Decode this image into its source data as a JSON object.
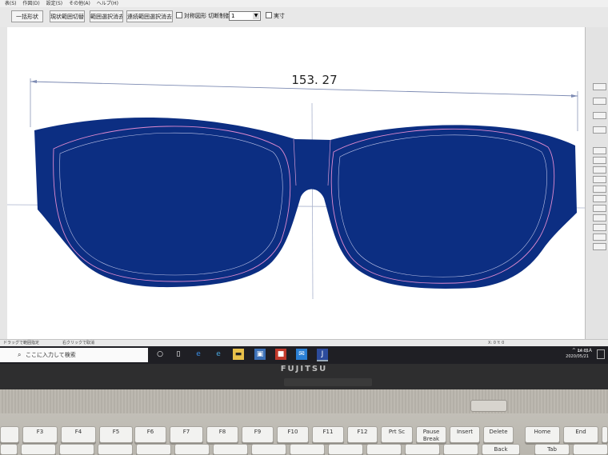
{
  "menu": {
    "items": [
      "表(S)",
      "作図(D)",
      "設定(S)",
      "その他(A)",
      "ヘルプ(H)"
    ]
  },
  "toolbar": {
    "buttons": [
      "一括形状",
      "現状範囲切替",
      "範囲選択消去",
      "連続範囲選択消去"
    ],
    "checkbox1_label": "対称図形 切断制御",
    "select_value": "1",
    "checkbox2_label": "実寸"
  },
  "drawing": {
    "dimension_value": "153. 27"
  },
  "colors": {
    "lens_fill": "#0c2e82",
    "outline_pink": "#e08ad0",
    "guide_line": "#9aa6c4"
  },
  "status": {
    "left_text": "ドラッグで範囲指定",
    "middle_text": "右クリックで取消",
    "right_text": "X: 0  Y: 0"
  },
  "taskbar": {
    "search_placeholder": "ここに入力して検索",
    "icons": [
      "task-view-icon",
      "edge-icon",
      "file-explorer-icon",
      "store-icon",
      "app-icon",
      "mail-icon",
      "cad-app-icon"
    ],
    "time": "14:01",
    "date": "2020/05/21"
  },
  "laptop": {
    "brand": "FUJITSU"
  },
  "keyboard": {
    "row1": [
      "F3",
      "F4",
      "F5",
      "F6",
      "F7",
      "F8",
      "F9",
      "F10",
      "F11",
      "F12",
      "Prt Sc",
      "Pause Break",
      "Insert",
      "Delete",
      "Home",
      "End"
    ],
    "row2_right": [
      "Back",
      "Tab"
    ]
  }
}
